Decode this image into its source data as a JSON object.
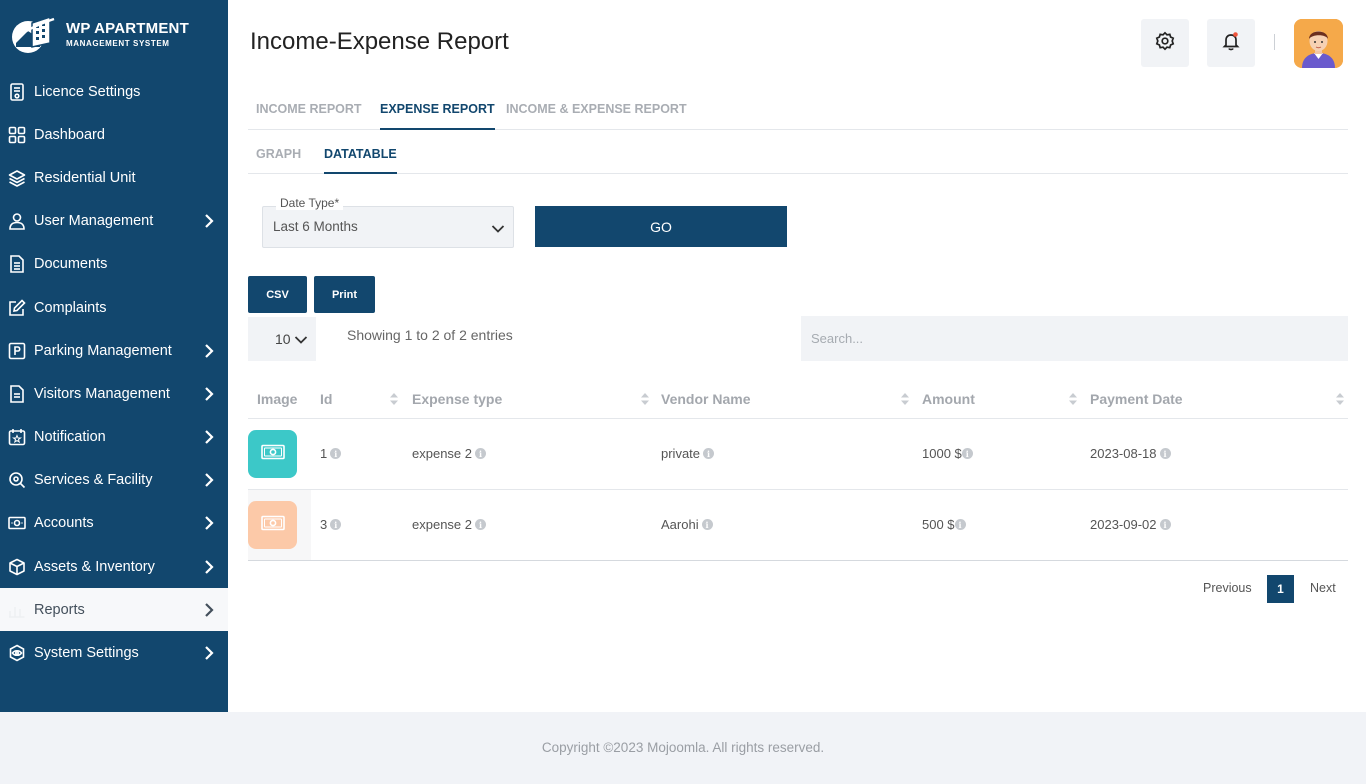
{
  "app": {
    "logo_title": "WP APARTMENT",
    "logo_subtitle": "MANAGEMENT SYSTEM"
  },
  "sidebar": {
    "items": [
      {
        "label": "Licence Settings",
        "icon": "licence-icon",
        "has_submenu": false
      },
      {
        "label": "Dashboard",
        "icon": "dashboard-icon",
        "has_submenu": false
      },
      {
        "label": "Residential Unit",
        "icon": "layers-icon",
        "has_submenu": false
      },
      {
        "label": "User Management",
        "icon": "user-icon",
        "has_submenu": true
      },
      {
        "label": "Documents",
        "icon": "document-icon",
        "has_submenu": false
      },
      {
        "label": "Complaints",
        "icon": "edit-icon",
        "has_submenu": false
      },
      {
        "label": "Parking Management",
        "icon": "parking-icon",
        "has_submenu": true
      },
      {
        "label": "Visitors Management",
        "icon": "visitors-icon",
        "has_submenu": true
      },
      {
        "label": "Notification",
        "icon": "calendar-star-icon",
        "has_submenu": true
      },
      {
        "label": "Services & Facility",
        "icon": "services-icon",
        "has_submenu": true
      },
      {
        "label": "Accounts",
        "icon": "money-icon",
        "has_submenu": true
      },
      {
        "label": "Assets & Inventory",
        "icon": "box-icon",
        "has_submenu": true
      },
      {
        "label": "Reports",
        "icon": "reports-icon",
        "has_submenu": true,
        "active": true
      },
      {
        "label": "System Settings",
        "icon": "settings-eye-icon",
        "has_submenu": true
      }
    ]
  },
  "header": {
    "title": "Income-Expense Report"
  },
  "tabs": [
    {
      "label": "INCOME REPORT"
    },
    {
      "label": "EXPENSE REPORT",
      "active": true
    },
    {
      "label": "INCOME & EXPENSE REPORT"
    }
  ],
  "subtabs": [
    {
      "label": "GRAPH"
    },
    {
      "label": "DATATABLE",
      "active": true
    }
  ],
  "filter": {
    "label": "Date Type*",
    "value": "Last 6 Months",
    "go_label": "GO"
  },
  "export": {
    "csv_label": "CSV",
    "print_label": "Print"
  },
  "datatable": {
    "page_length": "10",
    "info": "Showing 1 to 2 of 2 entries",
    "search_placeholder": "Search..."
  },
  "table": {
    "columns": [
      "Image",
      "Id",
      "Expense type",
      "Vendor Name",
      "Amount",
      "Payment Date"
    ],
    "rows": [
      {
        "id": "1",
        "expense_type": "expense 2",
        "vendor": "private",
        "amount": "1000 $",
        "date": "2023-08-18",
        "tile_color": "#3cc8c8"
      },
      {
        "id": "3",
        "expense_type": "expense 2",
        "vendor": "Aarohi",
        "amount": "500 $",
        "date": "2023-09-02",
        "tile_color": "#fcc9a8"
      }
    ]
  },
  "pagination": {
    "previous": "Previous",
    "current": "1",
    "next": "Next"
  },
  "footer": {
    "text": "Copyright ©2023 Mojoomla. All rights reserved."
  },
  "colors": {
    "primary": "#12476e",
    "active_bg": "#f7f8fa"
  }
}
